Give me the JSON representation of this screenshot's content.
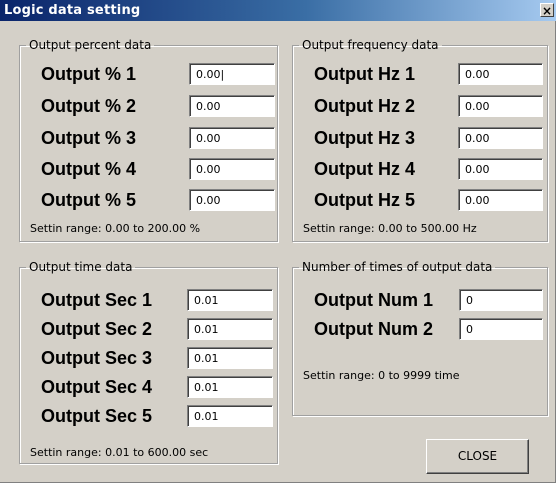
{
  "window": {
    "title": "Logic data setting",
    "close_glyph": "×"
  },
  "percent_group": {
    "legend": "Output percent data",
    "rows": [
      {
        "label": "Output % 1",
        "value": "0.00|"
      },
      {
        "label": "Output % 2",
        "value": "0.00"
      },
      {
        "label": "Output % 3",
        "value": "0.00"
      },
      {
        "label": "Output % 4",
        "value": "0.00"
      },
      {
        "label": "Output % 5",
        "value": "0.00"
      }
    ],
    "range": "Settin range: 0.00 to 200.00 %"
  },
  "frequency_group": {
    "legend": "Output frequency data",
    "rows": [
      {
        "label": "Output Hz 1",
        "value": "0.00"
      },
      {
        "label": "Output Hz 2",
        "value": "0.00"
      },
      {
        "label": "Output Hz 3",
        "value": "0.00"
      },
      {
        "label": "Output Hz 4",
        "value": "0.00"
      },
      {
        "label": "Output Hz 5",
        "value": "0.00"
      }
    ],
    "range": "Settin range: 0.00 to 500.00 Hz"
  },
  "time_group": {
    "legend": "Output time data",
    "rows": [
      {
        "label": "Output Sec 1",
        "value": "0.01"
      },
      {
        "label": "Output Sec 2",
        "value": "0.01"
      },
      {
        "label": "Output Sec 3",
        "value": "0.01"
      },
      {
        "label": "Output Sec 4",
        "value": "0.01"
      },
      {
        "label": "Output Sec 5",
        "value": "0.01"
      }
    ],
    "range": "Settin range: 0.01 to 600.00 sec"
  },
  "count_group": {
    "legend": "Number of times of output data",
    "rows": [
      {
        "label": "Output Num 1",
        "value": "0"
      },
      {
        "label": "Output Num 2",
        "value": "0"
      }
    ],
    "range": "Settin range: 0 to 9999 time"
  },
  "buttons": {
    "close_label": "CLOSE"
  }
}
